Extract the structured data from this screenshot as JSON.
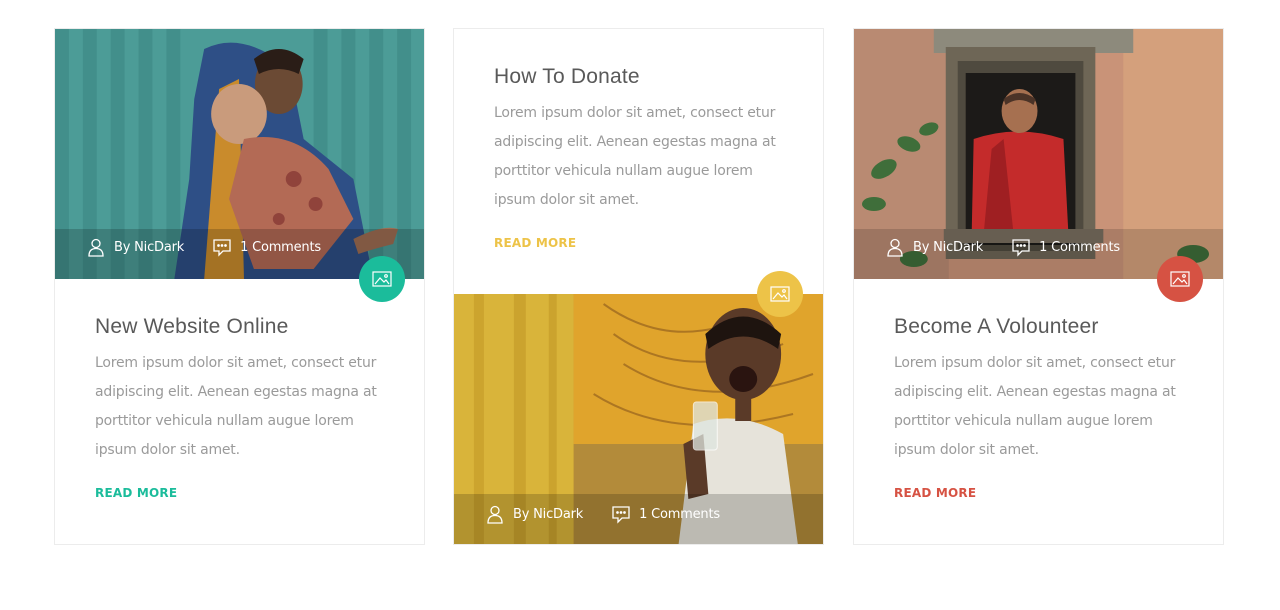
{
  "colors": {
    "teal": "#1bbc9b",
    "yellow": "#edc348",
    "red": "#d65243"
  },
  "icons": {
    "author": "user-icon",
    "comments": "comment-icon",
    "format": "image-icon"
  },
  "cards": [
    {
      "title": "New Website Online",
      "excerpt": "Lorem ipsum dolor sit amet, consect etur adipiscing elit. Aenean egestas magna at porttitor vehicula nullam augue lorem ipsum dolor sit amet.",
      "read_more": "READ MORE",
      "author": "By NicDark",
      "comments": "1 Comments"
    },
    {
      "title": "How To Donate",
      "excerpt": "Lorem ipsum dolor sit amet, consect etur adipiscing elit. Aenean egestas magna at porttitor vehicula nullam augue lorem ipsum dolor sit amet.",
      "read_more": "READ MORE",
      "author": "By NicDark",
      "comments": "1 Comments"
    },
    {
      "title": "Become A Volounteer",
      "excerpt": "Lorem ipsum dolor sit amet, consect etur adipiscing elit. Aenean egestas magna at porttitor vehicula nullam augue lorem ipsum dolor sit amet.",
      "read_more": "READ MORE",
      "author": "By NicDark",
      "comments": "1 Comments"
    }
  ]
}
